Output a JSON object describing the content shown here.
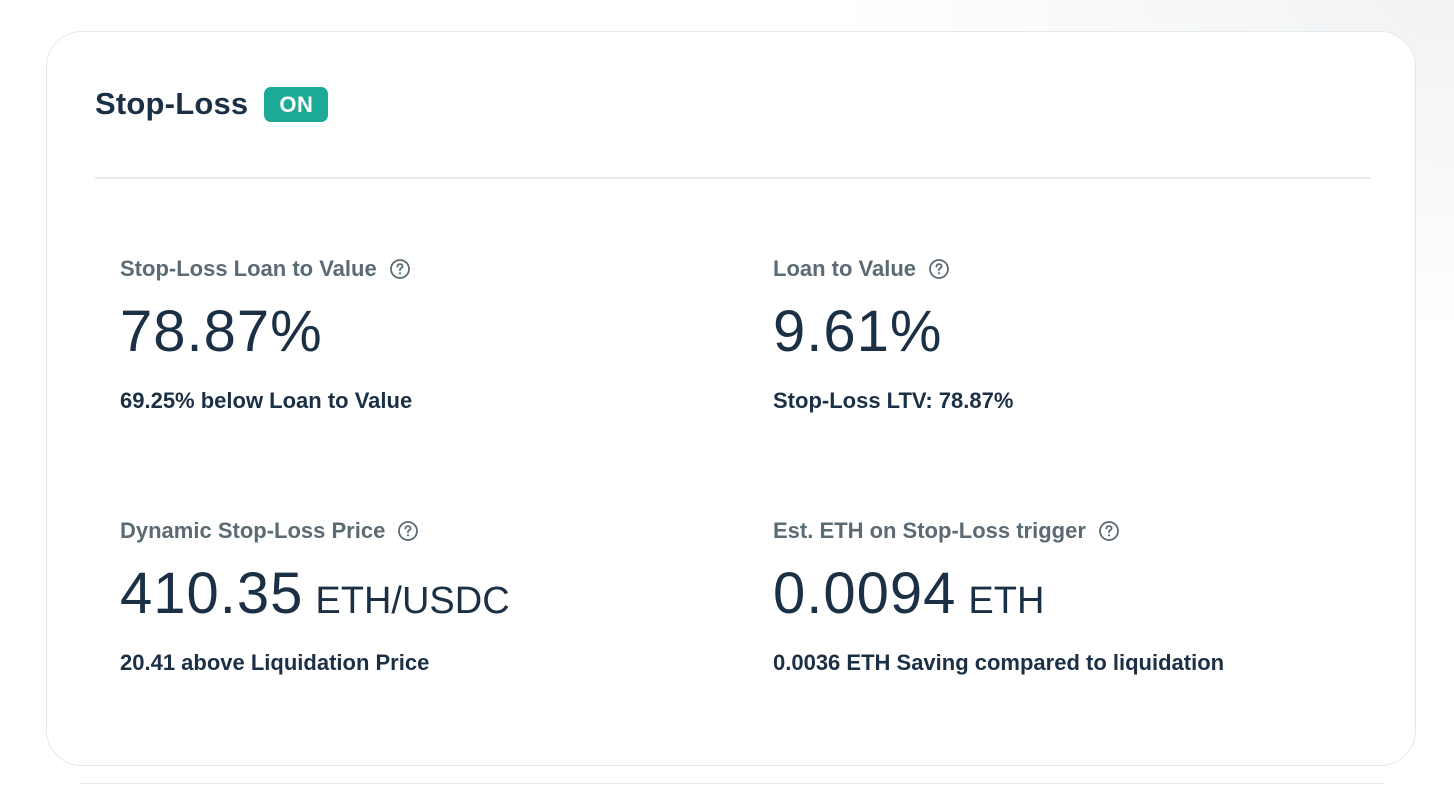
{
  "card": {
    "title": "Stop-Loss",
    "status_badge": "ON"
  },
  "stats": [
    {
      "label": "Stop-Loss Loan to Value",
      "value": "78.87%",
      "unit": "",
      "caption": "69.25% below Loan to Value",
      "icon": "help-icon"
    },
    {
      "label": "Loan to Value",
      "value": "9.61%",
      "unit": "",
      "caption": "Stop-Loss LTV: 78.87%",
      "icon": "help-icon"
    },
    {
      "label": "Dynamic Stop-Loss Price",
      "value": "410.35",
      "unit": "ETH/USDC",
      "caption": "20.41 above Liquidation Price",
      "icon": "help-icon"
    },
    {
      "label": "Est. ETH on Stop-Loss trigger",
      "value": "0.0094",
      "unit": "ETH",
      "caption": "0.0036 ETH Saving compared to liquidation",
      "icon": "help-icon"
    }
  ],
  "colors": {
    "accent": "#1aaa96",
    "text_primary": "#1b2f45",
    "text_secondary": "#5b6b74",
    "border": "#e6e9ec"
  }
}
